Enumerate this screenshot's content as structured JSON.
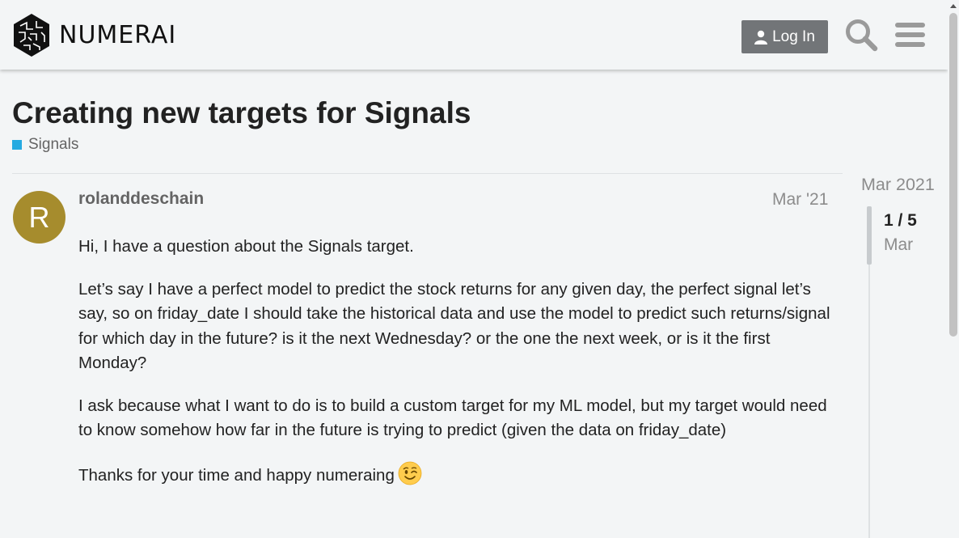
{
  "header": {
    "logo_text": "NUMERAI",
    "login_label": "Log In",
    "icons": {
      "search": "search-icon",
      "menu": "hamburger-menu-icon",
      "login": "user-icon"
    }
  },
  "topic": {
    "title": "Creating new targets for Signals",
    "category": "Signals",
    "category_color": "#25aae1"
  },
  "post": {
    "avatar_letter": "R",
    "avatar_color": "#a68c2d",
    "username": "rolanddeschain",
    "date": "Mar '21",
    "paragraphs": [
      "Hi, I have a question about the Signals target.",
      "Let’s say I have a perfect model to predict the stock returns for any given day, the perfect signal let’s say, so on friday_date I should take the historical data and use the model to predict such returns/signal for which day in the future? is it the next Wednesday? or the one the next week, or is it the first Monday?",
      "I ask because what I want to do is to build a custom target for my ML model, but my target would need to know somehow how far in the future is trying to predict (given the data on friday_date)",
      "Thanks for your time and happy numeraing"
    ],
    "emoji": "wink-emoji"
  },
  "timeline": {
    "top_date": "Mar 2021",
    "count": "1 / 5",
    "current_date": "Mar"
  }
}
